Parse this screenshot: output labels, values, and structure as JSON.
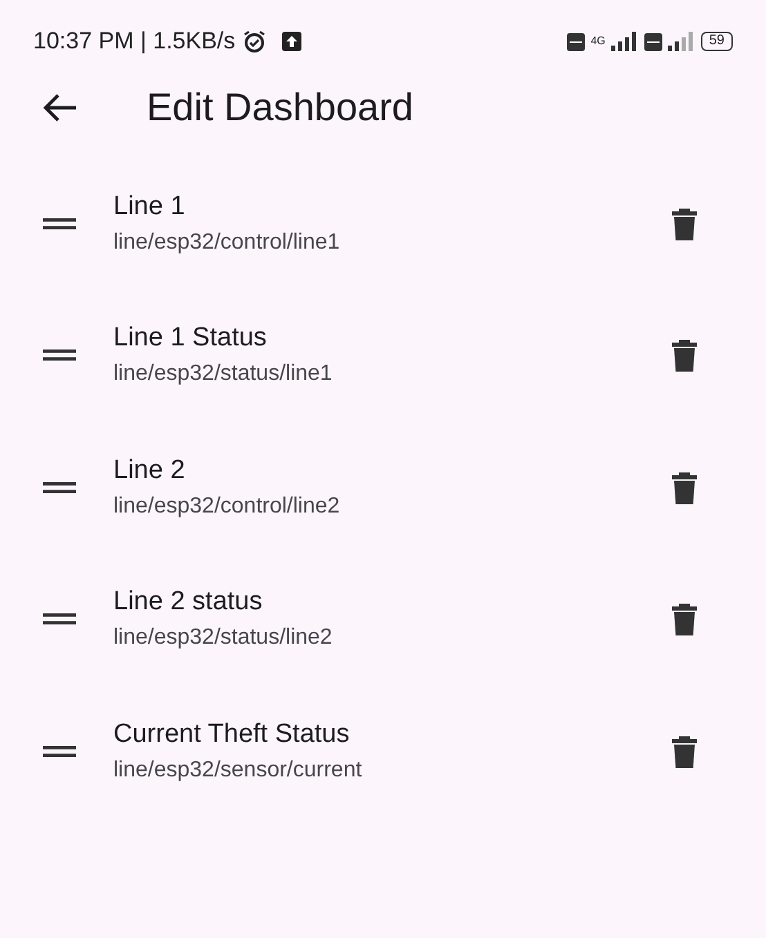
{
  "status_bar": {
    "time_speed": "10:37 PM | 1.5KB/s",
    "network": "4G",
    "battery": "59"
  },
  "app_bar": {
    "title": "Edit Dashboard"
  },
  "items": [
    {
      "title": "Line 1",
      "topic": "line/esp32/control/line1"
    },
    {
      "title": "Line 1 Status",
      "topic": "line/esp32/status/line1"
    },
    {
      "title": "Line 2",
      "topic": "line/esp32/control/line2"
    },
    {
      "title": "Line 2 status",
      "topic": "line/esp32/status/line2"
    },
    {
      "title": "Current Theft Status",
      "topic": "line/esp32/sensor/current"
    }
  ]
}
